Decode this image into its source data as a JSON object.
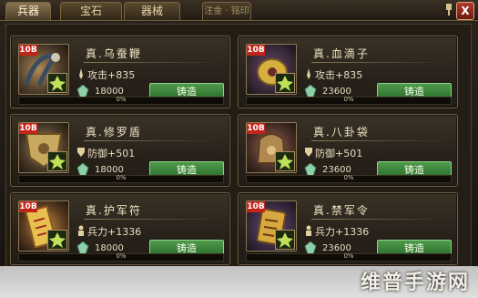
{
  "tabs": [
    {
      "label": "兵器",
      "active": true
    },
    {
      "label": "宝石",
      "active": false
    },
    {
      "label": "器械",
      "active": false
    },
    {
      "label": "注金 · 铭印",
      "active": false
    }
  ],
  "close_label": "X",
  "items": [
    {
      "name": "真.乌蚕鞭",
      "level": "10B",
      "stat": "攻击+835",
      "stat_icon": "sword-icon",
      "cost": "18000",
      "forge": "铸造",
      "progress": "0%",
      "progress_value": 0
    },
    {
      "name": "真.血滴子",
      "level": "10B",
      "stat": "攻击+835",
      "stat_icon": "sword-icon",
      "cost": "23600",
      "forge": "铸造",
      "progress": "0%",
      "progress_value": 0
    },
    {
      "name": "真.修罗盾",
      "level": "10B",
      "stat": "防御+501",
      "stat_icon": "shield-icon",
      "cost": "18000",
      "forge": "铸造",
      "progress": "0%",
      "progress_value": 0
    },
    {
      "name": "真.八卦袋",
      "level": "10B",
      "stat": "防御+501",
      "stat_icon": "shield-icon",
      "cost": "23600",
      "forge": "铸造",
      "progress": "0%",
      "progress_value": 0
    },
    {
      "name": "真.护军符",
      "level": "10B",
      "stat": "兵力+1336",
      "stat_icon": "soldier-icon",
      "cost": "18000",
      "forge": "铸造",
      "progress": "0%",
      "progress_value": 0
    },
    {
      "name": "真.禁军令",
      "level": "10B",
      "stat": "兵力+1336",
      "stat_icon": "soldier-icon",
      "cost": "23600",
      "forge": "铸造",
      "progress": "0%",
      "progress_value": 0
    }
  ],
  "watermark": "维普手游网",
  "colors": {
    "forge_green": "#3f8a3c",
    "level_red": "#c3241a",
    "gold_border": "#8d7a55"
  }
}
